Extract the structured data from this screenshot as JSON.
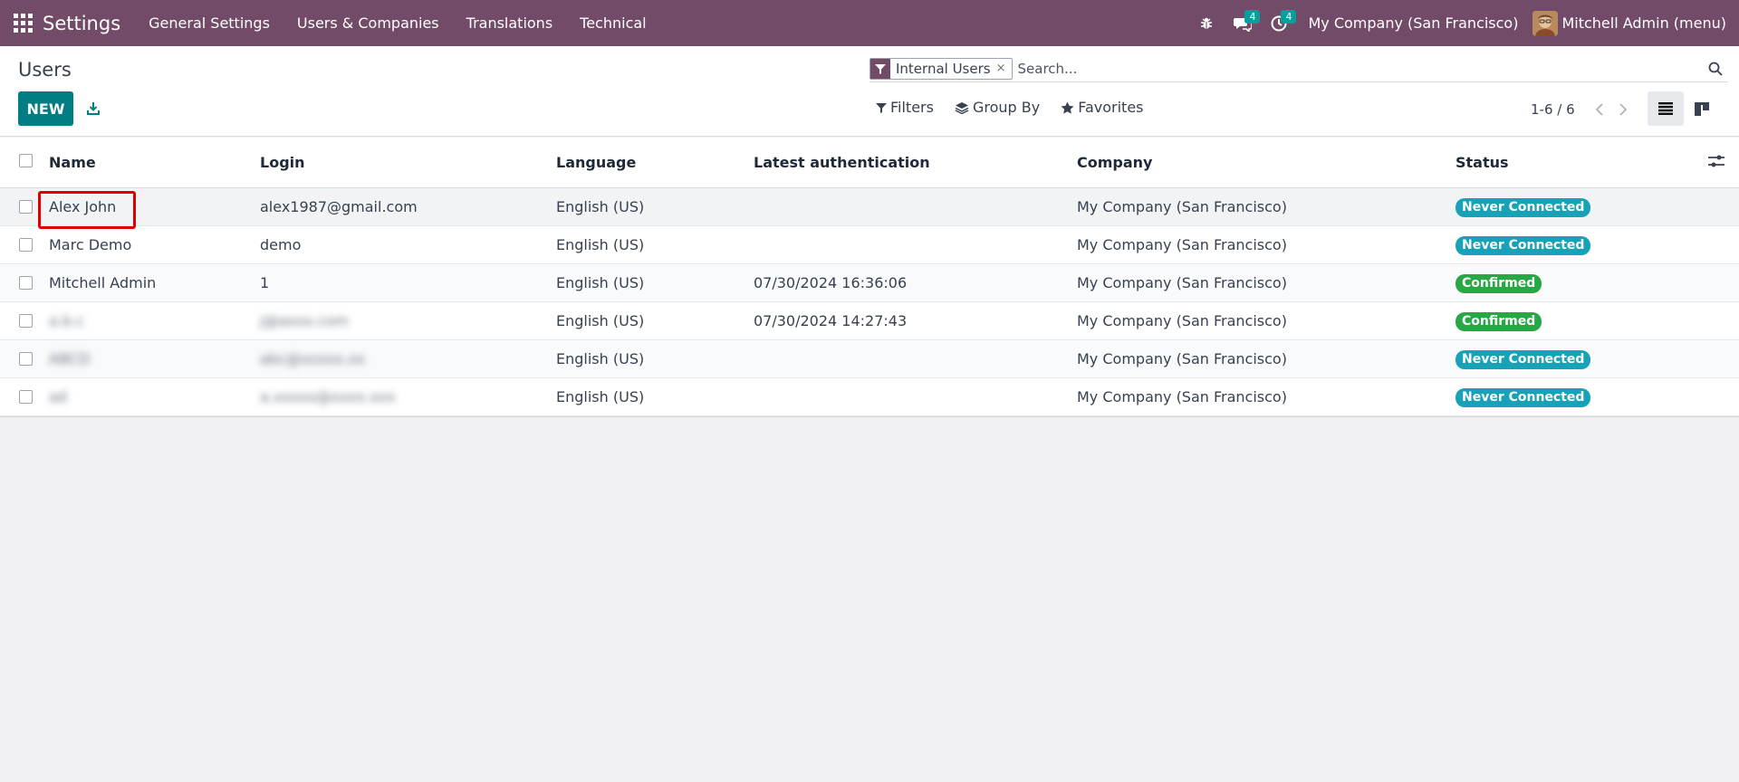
{
  "navbar": {
    "brand": "Settings",
    "menu": [
      "General Settings",
      "Users & Companies",
      "Translations",
      "Technical"
    ],
    "messages_count": "4",
    "activities_count": "4",
    "company": "My Company (San Francisco)",
    "user": "Mitchell Admin (menu)"
  },
  "control": {
    "title": "Users",
    "new_label": "NEW",
    "facet_label": "Internal Users",
    "facet_remove": "×",
    "search_placeholder": "Search...",
    "filters_label": "Filters",
    "groupby_label": "Group By",
    "favorites_label": "Favorites",
    "pager_value": "1-6 / 6"
  },
  "columns": {
    "name": "Name",
    "login": "Login",
    "language": "Language",
    "auth": "Latest authentication",
    "company": "Company",
    "status": "Status"
  },
  "rows": [
    {
      "name": "Alex John",
      "login": "alex1987@gmail.com",
      "language": "English (US)",
      "auth": "",
      "company": "My Company (San Francisco)",
      "status": "Never Connected"
    },
    {
      "name": "Marc Demo",
      "login": "demo",
      "language": "English (US)",
      "auth": "",
      "company": "My Company (San Francisco)",
      "status": "Never Connected"
    },
    {
      "name": "Mitchell Admin",
      "login": "1",
      "language": "English (US)",
      "auth": "07/30/2024 16:36:06",
      "company": "My Company (San Francisco)",
      "status": "Confirmed"
    },
    {
      "name": "a.b.c",
      "login": "j@axxx.com",
      "language": "English (US)",
      "auth": "07/30/2024 14:27:43",
      "company": "My Company (San Francisco)",
      "status": "Confirmed"
    },
    {
      "name": "ABCD",
      "login": "abc@xxxxx.xx",
      "language": "English (US)",
      "auth": "",
      "company": "My Company (San Francisco)",
      "status": "Never Connected"
    },
    {
      "name": "ad",
      "login": "a.xxxxx@xxxx.xxx",
      "language": "English (US)",
      "auth": "",
      "company": "My Company (San Francisco)",
      "status": "Never Connected"
    }
  ],
  "colors": {
    "brand": "#714b67",
    "primary": "#017e84",
    "never_connected": "#17a2b8",
    "confirmed": "#28a745",
    "highlight": "#e00000"
  }
}
